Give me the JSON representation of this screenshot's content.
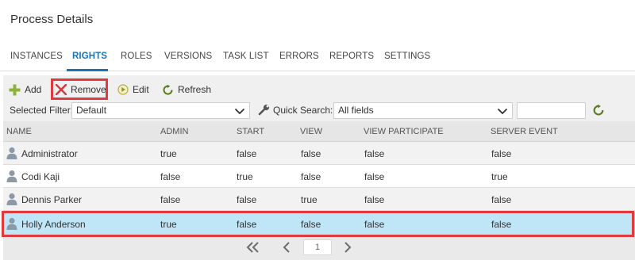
{
  "page_title": "Process Details",
  "tabs": [
    {
      "label": "INSTANCES",
      "active": false
    },
    {
      "label": "RIGHTS",
      "active": true
    },
    {
      "label": "ROLES",
      "active": false
    },
    {
      "label": "VERSIONS",
      "active": false
    },
    {
      "label": "TASK LIST",
      "active": false
    },
    {
      "label": "ERRORS",
      "active": false
    },
    {
      "label": "REPORTS",
      "active": false
    },
    {
      "label": "SETTINGS",
      "active": false
    }
  ],
  "toolbar": {
    "add": "Add",
    "remove": "Remove",
    "edit": "Edit",
    "refresh": "Refresh"
  },
  "filter": {
    "selected_filter_label": "Selected Filter:",
    "selected_filter_value": "Default",
    "quick_search_label": "Quick Search:",
    "quick_search_value": "All fields",
    "search_text": ""
  },
  "grid": {
    "columns": [
      "NAME",
      "ADMIN",
      "START",
      "VIEW",
      "VIEW PARTICIPATE",
      "SERVER EVENT"
    ],
    "rows": [
      {
        "name": "Administrator",
        "admin": "true",
        "start": "false",
        "view": "false",
        "view_participate": "false",
        "server_event": "false",
        "selected": false
      },
      {
        "name": "Codi Kaji",
        "admin": "false",
        "start": "true",
        "view": "false",
        "view_participate": "false",
        "server_event": "true",
        "selected": false
      },
      {
        "name": "Dennis Parker",
        "admin": "false",
        "start": "false",
        "view": "true",
        "view_participate": "false",
        "server_event": "false",
        "selected": false
      },
      {
        "name": "Holly Anderson",
        "admin": "true",
        "start": "false",
        "view": "false",
        "view_participate": "false",
        "server_event": "false",
        "selected": true
      }
    ]
  },
  "pager": {
    "current_page": "1"
  },
  "colors": {
    "accent": "#1a73b8",
    "highlight": "#e0393e",
    "selected_row": "#bfe6f7",
    "add_icon": "#8db33a",
    "remove_icon": "#d9363b",
    "refresh_icon": "#5c7a1e"
  }
}
